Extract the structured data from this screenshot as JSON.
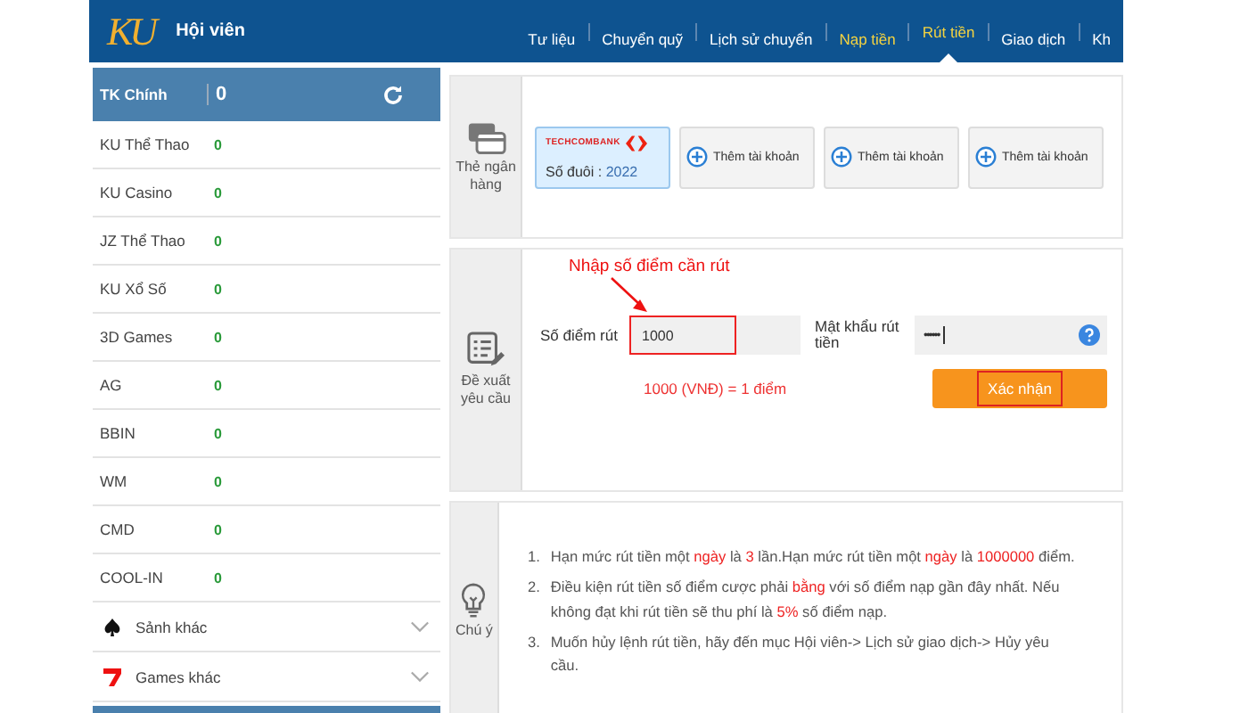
{
  "header": {
    "title": "Hội viên",
    "logo": "KU",
    "nav": [
      {
        "label": "Tư liệu",
        "highlighted": false,
        "selected": false
      },
      {
        "label": "Chuyển quỹ",
        "highlighted": false,
        "selected": false
      },
      {
        "label": "Lịch sử chuyển",
        "highlighted": false,
        "selected": false
      },
      {
        "label": "Nạp tiền",
        "highlighted": true,
        "selected": false
      },
      {
        "label": "Rút tiền",
        "highlighted": true,
        "selected": true
      },
      {
        "label": "Giao dịch",
        "highlighted": false,
        "selected": false
      },
      {
        "label": "Kh",
        "highlighted": false,
        "selected": false
      }
    ]
  },
  "sidebar": {
    "main": {
      "label": "TK Chính",
      "value": "0"
    },
    "wallets": [
      {
        "name": "KU Thể Thao",
        "value": "0"
      },
      {
        "name": "KU Casino",
        "value": "0"
      },
      {
        "name": "JZ Thể Thao",
        "value": "0"
      },
      {
        "name": "KU Xổ Số",
        "value": "0"
      },
      {
        "name": "3D Games",
        "value": "0"
      },
      {
        "name": "AG",
        "value": "0"
      },
      {
        "name": "BBIN",
        "value": "0"
      },
      {
        "name": "WM",
        "value": "0"
      },
      {
        "name": "CMD",
        "value": "0"
      },
      {
        "name": "COOL-IN",
        "value": "0"
      }
    ],
    "groups": [
      {
        "label": "Sảnh khác",
        "kind": "spade",
        "expanded": false
      },
      {
        "label": "Games khác",
        "kind": "seven",
        "expanded": false
      }
    ]
  },
  "bank_panel": {
    "label": "Thẻ ngân hàng",
    "cards": [
      {
        "kind": "bank",
        "bank": "TECHCOMBANK",
        "suffix_label": "Số đuôi :",
        "suffix": "2022",
        "selected": true
      },
      {
        "kind": "add",
        "label": "Thêm tài khoản",
        "selected": false
      },
      {
        "kind": "add",
        "label": "Thêm tài khoản",
        "selected": false
      },
      {
        "kind": "add",
        "label": "Thêm tài khoản",
        "selected": false
      }
    ]
  },
  "request_panel": {
    "label": "Đề xuất yêu cầu",
    "annotation": "Nhập số điểm cần rút",
    "amount": {
      "label": "Số điểm rút",
      "value": "1000",
      "outlined": true
    },
    "password": {
      "label": "Mật khẩu rút tiền",
      "value": "••••••"
    },
    "rate": "1000 (VNĐ) = 1 điểm",
    "confirm": {
      "label": "Xác nhận",
      "outlined": true
    }
  },
  "notes_panel": {
    "label": "Chú ý",
    "notes": [
      {
        "number": "1.",
        "text": "Hạn mức rút tiền một **ngày** là **3** lần.Hạn mức rút tiền một **ngày** là **1000000** điểm."
      },
      {
        "number": "2.",
        "text": "Điều kiện rút tiền số điểm cược phải **bằng** với số điểm nạp gần đây nhất. Nếu không đạt khi rút tiền sẽ thu phí là **5%** số điểm nạp."
      },
      {
        "number": "3.",
        "text": "Muốn hủy lệnh rút tiền, hãy đến mục Hội viên-> Lịch sử giao dịch-> Hủy yêu cầu."
      }
    ]
  }
}
